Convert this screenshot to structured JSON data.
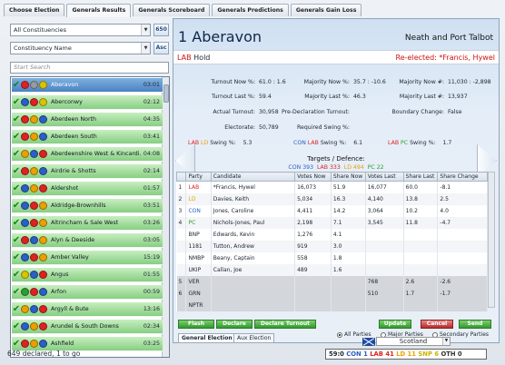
{
  "tabs": [
    "Choose Election",
    "Generals Results",
    "Generals Scoreboard",
    "Generals Predictions",
    "Generals Gain Loss"
  ],
  "left": {
    "filter": "All Constituencies",
    "count": "650",
    "sort": "Constituency Name",
    "sort_button": "Asc",
    "search_placeholder": "Start Search",
    "status": "649 declared, 1 to go",
    "rows": [
      {
        "name": "Aberavon",
        "time": "03:01",
        "balls": [
          "#d22",
          "#999",
          "#d8c400"
        ]
      },
      {
        "name": "Aberconwy",
        "time": "02:12",
        "balls": [
          "#2a5fc4",
          "#d22",
          "#d8c400"
        ]
      },
      {
        "name": "Aberdeen North",
        "time": "04:35",
        "balls": [
          "#d22",
          "#e9a100",
          "#2a5fc4"
        ]
      },
      {
        "name": "Aberdeen South",
        "time": "03:41",
        "balls": [
          "#d22",
          "#e9a100",
          "#2a5fc4"
        ]
      },
      {
        "name": "Aberdeenshire West & Kincardi...",
        "time": "04:08",
        "balls": [
          "#e9a100",
          "#2a5fc4",
          "#d22"
        ]
      },
      {
        "name": "Airdrie & Shotts",
        "time": "02:14",
        "balls": [
          "#d22",
          "#e9a100",
          "#2a5fc4"
        ]
      },
      {
        "name": "Aldershot",
        "time": "01:57",
        "balls": [
          "#2a5fc4",
          "#e9a100",
          "#d22"
        ]
      },
      {
        "name": "Aldridge-Brownhills",
        "time": "03:51",
        "balls": [
          "#2a5fc4",
          "#d22",
          "#e9a100"
        ]
      },
      {
        "name": "Altrincham & Sale West",
        "time": "03:26",
        "balls": [
          "#2a5fc4",
          "#d22",
          "#e9a100"
        ]
      },
      {
        "name": "Alyn & Deeside",
        "time": "03:05",
        "balls": [
          "#d22",
          "#2a5fc4",
          "#e9a100"
        ]
      },
      {
        "name": "Amber Valley",
        "time": "15:19",
        "balls": [
          "#2a5fc4",
          "#d22",
          "#e9a100"
        ]
      },
      {
        "name": "Angus",
        "time": "01:55",
        "balls": [
          "#d8c400",
          "#2a5fc4",
          "#d22"
        ]
      },
      {
        "name": "Arfon",
        "time": "00:59",
        "balls": [
          "#2d9d2d",
          "#d22",
          "#2a5fc4"
        ]
      },
      {
        "name": "Argyll & Bute",
        "time": "13:16",
        "balls": [
          "#e9a100",
          "#2a5fc4",
          "#d22"
        ]
      },
      {
        "name": "Arundel & South Downs",
        "time": "02:34",
        "balls": [
          "#2a5fc4",
          "#e9a100",
          "#d22"
        ]
      },
      {
        "name": "Ashfield",
        "time": "03:25",
        "balls": [
          "#d22",
          "#e9a100",
          "#2a5fc4"
        ]
      }
    ]
  },
  "main": {
    "title": "1 Aberavon",
    "region": "Neath and Port Talbot",
    "hold_party": "LAB",
    "hold_text": "Hold",
    "reelected": "Re-elected: *Francis, Hywel",
    "stats": [
      {
        "label": "Turnout Now %:",
        "value": "61.0 : 1.6"
      },
      {
        "label": "Turnout Last %:",
        "value": "59.4"
      },
      {
        "label": "Actual Turnout:",
        "value": "30,958"
      },
      {
        "label": "Electorate:",
        "value": "50,789"
      },
      {
        "label": "Majority Now %:",
        "value": "35.7 : -10.6"
      },
      {
        "label": "Majority Last %:",
        "value": "46.3"
      },
      {
        "label": "Pre-Declaration Turnout:",
        "value": ""
      },
      {
        "label": "Required Swing %:",
        "value": ""
      },
      {
        "label": "Majority Now #:",
        "value": "11,030 : -2,898"
      },
      {
        "label": "Majority Last #:",
        "value": "13,937"
      },
      {
        "label": "Boundary Change:",
        "value": "False"
      }
    ],
    "swings": [
      {
        "a": "LAB",
        "b": "LD",
        "label": "Swing %:",
        "value": "5.3"
      },
      {
        "a": "CON",
        "b": "LAB",
        "label": "Swing %:",
        "value": "6.1"
      },
      {
        "a": "LAB",
        "b": "PC",
        "label": "Swing %:",
        "value": "1.7"
      }
    ],
    "targets_title": "Targets / Defence:",
    "targets": [
      {
        "text": "CON 393",
        "color": "#2a5fc4"
      },
      {
        "text": "LAB 333",
        "color": "#d22"
      },
      {
        "text": "LD 494",
        "color": "#e9a100"
      },
      {
        "text": "PC 22",
        "color": "#2d9d2d"
      }
    ],
    "table": {
      "headers": [
        "",
        "Party",
        "Candidate",
        "Votes Now",
        "Share Now",
        "Votes Last",
        "Share Last",
        "Share Change"
      ],
      "rows": [
        [
          "1",
          "LAB",
          "*Francis, Hywel",
          "16,073",
          "51.9",
          "16,077",
          "60.0",
          "-8.1"
        ],
        [
          "2",
          "LD",
          "Davies, Keith",
          "5,034",
          "16.3",
          "4,140",
          "13.8",
          "2.5"
        ],
        [
          "3",
          "CON",
          "Jones, Caroline",
          "4,411",
          "14.2",
          "3,064",
          "10.2",
          "4.0"
        ],
        [
          "4",
          "PC",
          "Nichols-Jones, Paul",
          "2,198",
          "7.1",
          "3,545",
          "11.8",
          "-4.7"
        ],
        [
          "",
          "BNP",
          "Edwards, Kevin",
          "1,276",
          "4.1",
          "",
          "",
          ""
        ],
        [
          "",
          "1181",
          "Tutton, Andrew",
          "919",
          "3.0",
          "",
          "",
          ""
        ],
        [
          "",
          "NMBP",
          "Beany, Captain",
          "558",
          "1.8",
          "",
          "",
          ""
        ],
        [
          "",
          "UKIP",
          "Callan, Joe",
          "489",
          "1.6",
          "",
          "",
          ""
        ],
        [
          "5",
          "VER",
          "",
          "",
          "",
          "768",
          "2.6",
          "-2.6"
        ],
        [
          "6",
          "GRN",
          "",
          "",
          "",
          "510",
          "1.7",
          "-1.7"
        ],
        [
          "",
          "NPTR",
          "",
          "",
          "",
          "",
          "",
          ""
        ]
      ]
    },
    "party_colors": {
      "LAB": "#d22",
      "LD": "#e9a100",
      "CON": "#2a5fc4",
      "PC": "#2d9d2d"
    },
    "buttons": {
      "flash": "Flash",
      "declare": "Declare",
      "declare_turnout": "Declare Turnout",
      "update": "Update",
      "cancel": "Cancel",
      "send": "Send"
    },
    "subtabs": [
      "General Election",
      "Aux Election"
    ],
    "radios": [
      "All Parties",
      "Major Parties",
      "Secondary Parties"
    ]
  },
  "footer": {
    "region": "Scotland",
    "score_label": "59:0",
    "scores": [
      {
        "text": "CON 1",
        "color": "#2a5fc4"
      },
      {
        "text": "LAB 41",
        "color": "#d22"
      },
      {
        "text": "LD 11",
        "color": "#e9a100"
      },
      {
        "text": "SNP 6",
        "color": "#c9b200"
      },
      {
        "text": "OTH 0",
        "color": "#333"
      }
    ]
  }
}
